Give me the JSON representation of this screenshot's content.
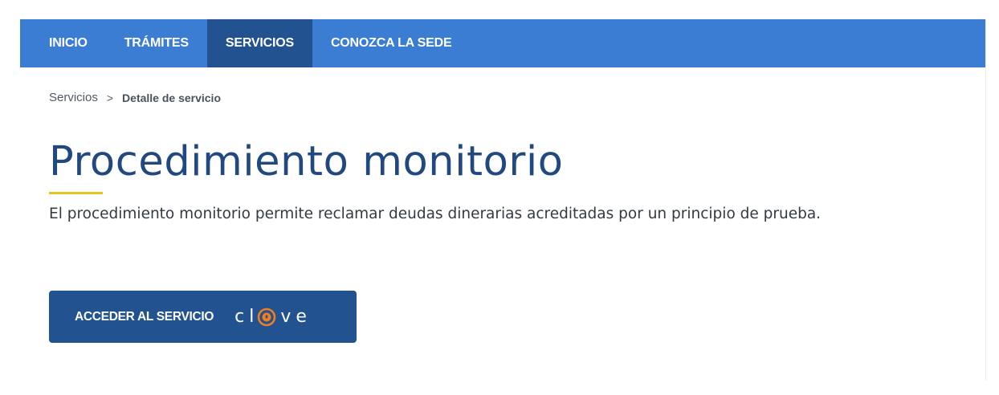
{
  "nav": {
    "items": [
      {
        "label": "INICIO"
      },
      {
        "label": "TRÁMITES"
      },
      {
        "label": "SERVICIOS",
        "active": true
      },
      {
        "label": "CONOZCA LA SEDE"
      }
    ]
  },
  "breadcrumb": {
    "parent": "Servicios",
    "separator": ">",
    "current": "Detalle de servicio"
  },
  "main": {
    "title": "Procedimiento monitorio",
    "description": "El procedimiento monitorio permite reclamar deudas dinerarias acreditadas por un principio de prueba.",
    "access_button_label": "ACCEDER AL SERVICIO",
    "clave_logo": {
      "letters": [
        "c",
        "l",
        "v",
        "e"
      ],
      "icon": "clave-lock-icon"
    }
  },
  "colors": {
    "nav_background": "#3b7dd2",
    "nav_active": "#22528f",
    "title": "#21487f",
    "accent_underline": "#e8c41f",
    "clave_orange": "#f07d1f"
  }
}
